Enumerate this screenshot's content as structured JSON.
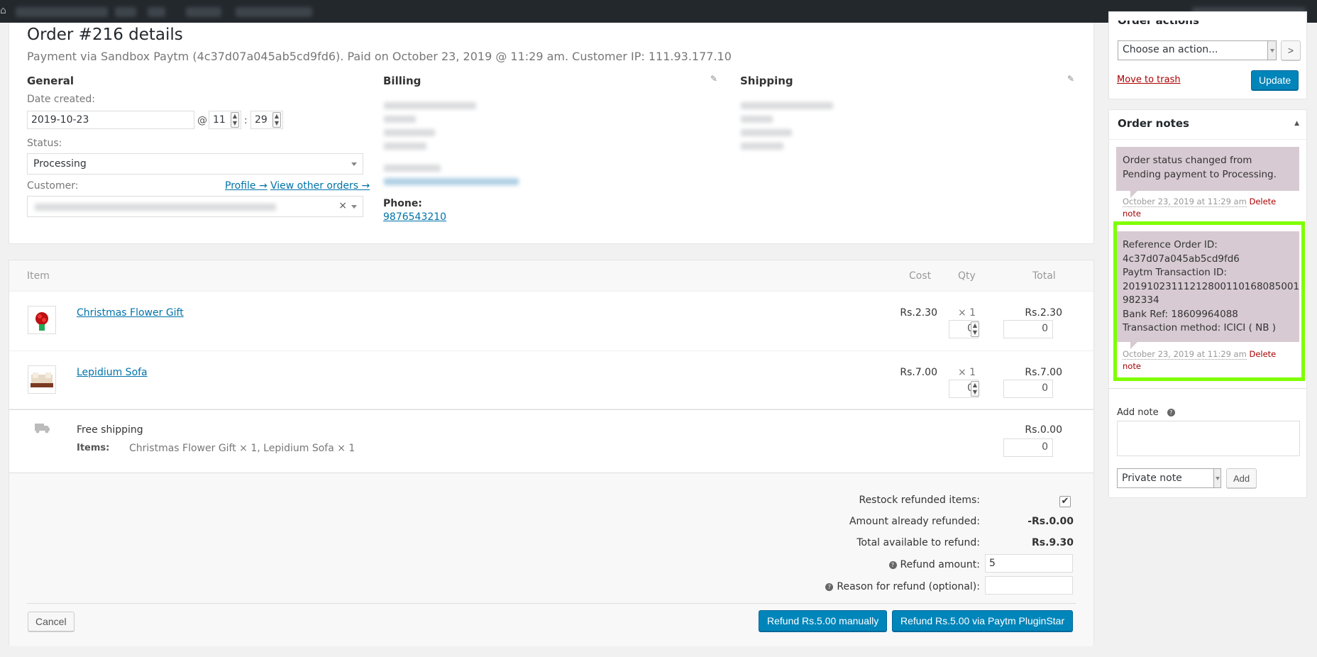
{
  "order": {
    "title": "Order #216 details",
    "meta": "Payment via Sandbox Paytm (4c37d07a045ab5cd9fd6). Paid on October 23, 2019 @ 11:29 am. Customer IP: 111.93.177.10"
  },
  "general": {
    "heading": "General",
    "date_label": "Date created:",
    "date_value": "2019-10-23",
    "at": "@",
    "hour": "11",
    "colon": ":",
    "minute": "29",
    "status_label": "Status:",
    "status_value": "Processing",
    "customer_label": "Customer:",
    "profile_link": "Profile →",
    "other_orders_link": "View other orders →",
    "clear_symbol": "×"
  },
  "billing": {
    "heading": "Billing",
    "phone_label": "Phone:",
    "phone_value": "9876543210"
  },
  "shipping": {
    "heading": "Shipping"
  },
  "items_table": {
    "headers": {
      "item": "Item",
      "cost": "Cost",
      "qty": "Qty",
      "total": "Total"
    },
    "rows": [
      {
        "name": "Christmas Flower Gift",
        "cost": "Rs.2.30",
        "qty": "× 1",
        "total": "Rs.2.30",
        "refund_qty": "0",
        "refund_total": "0"
      },
      {
        "name": "Lepidium Sofa",
        "cost": "Rs.7.00",
        "qty": "× 1",
        "total": "Rs.7.00",
        "refund_qty": "0",
        "refund_total": "0"
      }
    ],
    "shipping_row": {
      "name": "Free shipping",
      "items_label": "Items:",
      "items_value": "Christmas Flower Gift × 1, Lepidium Sofa × 1",
      "total": "Rs.0.00",
      "refund_total": "0"
    }
  },
  "refund": {
    "restock_label": "Restock refunded items:",
    "restock_checked": "✔",
    "already_refunded_label": "Amount already refunded:",
    "already_refunded_value": "-Rs.0.00",
    "available_label": "Total available to refund:",
    "available_value": "Rs.9.30",
    "help_glyph": "?",
    "amount_label": "Refund amount:",
    "amount_value": "5",
    "reason_label": "Reason for refund (optional):",
    "reason_value": "",
    "cancel_button": "Cancel",
    "manual_button": "Refund Rs.5.00 manually",
    "paytm_button": "Refund Rs.5.00 via Paytm PluginStar"
  },
  "order_actions": {
    "title": "Order actions",
    "select_value": "Choose an action...",
    "go_button": ">",
    "trash_link": "Move to trash",
    "update_button": "Update"
  },
  "order_notes": {
    "title": "Order notes",
    "toggle_glyph": "▲",
    "notes": [
      {
        "text": "Order status changed from Pending payment to Processing.",
        "date": "October 23, 2019 at 11:29 am",
        "delete": "Delete note"
      },
      {
        "lines": [
          "Reference Order ID:",
          "4c37d07a045ab5cd9fd6",
          "Paytm Transaction ID:",
          "20191023111212800110168085001",
          "982334",
          "Bank Ref: 18609964088",
          "Transaction method: ICICI ( NB )"
        ],
        "date": "October 23, 2019 at 11:29 am",
        "delete": "Delete note"
      }
    ],
    "add_note_label": "Add note",
    "help_glyph": "?",
    "note_type_value": "Private note",
    "add_button": "Add"
  },
  "colors": {
    "accent": "#0085ba",
    "link": "#0073aa",
    "note_bg": "#d7cad2",
    "highlight": "#7fff00",
    "delete_link": "#a00"
  }
}
